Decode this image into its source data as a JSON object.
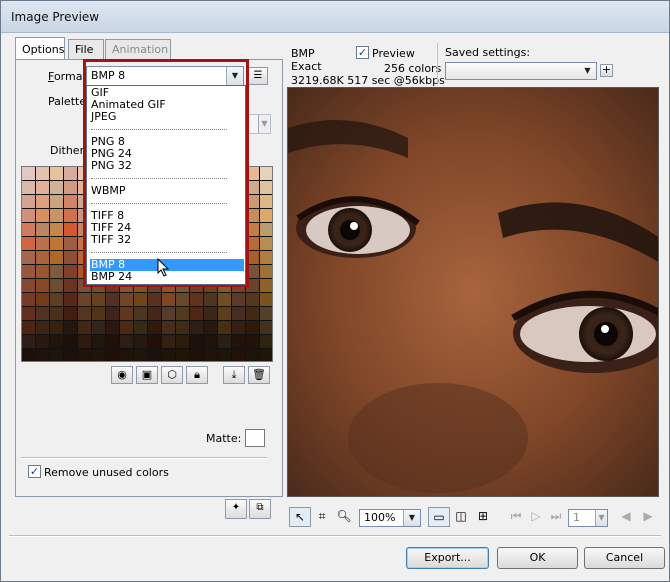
{
  "window": {
    "title": "Image Preview"
  },
  "tabs": [
    {
      "label": "Options",
      "state": "active"
    },
    {
      "label": "File",
      "state": "normal"
    },
    {
      "label": "Animation",
      "state": "disabled"
    }
  ],
  "options": {
    "format_label": "Format:",
    "format_value": "BMP 8",
    "palette_label": "Palette:",
    "dither_label": "Dither:",
    "matte_label": "Matte:",
    "remove_unused_colors_label": "Remove unused colors",
    "remove_unused_colors_checked": true
  },
  "format_dropdown": {
    "groups": [
      [
        "GIF",
        "Animated GIF",
        "JPEG"
      ],
      [
        "PNG 8",
        "PNG 24",
        "PNG 32"
      ],
      [
        "WBMP"
      ],
      [
        "TIFF 8",
        "TIFF 24",
        "TIFF 32"
      ],
      [
        "BMP 8",
        "BMP 24"
      ]
    ],
    "highlighted": "BMP 8",
    "outline_color": "#a01414",
    "highlight_color": "#3399ff"
  },
  "preview_info": {
    "format": "BMP",
    "palette": "Exact",
    "colors": "256 colors",
    "size_time": "3219.68K  517 sec @56kbps",
    "preview_label": "Preview",
    "preview_checked": true,
    "saved_settings_label": "Saved settings:",
    "saved_settings_value": ""
  },
  "toolbar": {
    "icons": [
      "pointer-icon",
      "crop-icon",
      "zoom-icon"
    ],
    "zoom_value": "100%",
    "view_icons": [
      "preview-view-icon",
      "two-up-icon",
      "four-up-icon"
    ],
    "frame_value": "1"
  },
  "buttons": {
    "export": "Export...",
    "ok": "OK",
    "cancel": "Cancel"
  }
}
